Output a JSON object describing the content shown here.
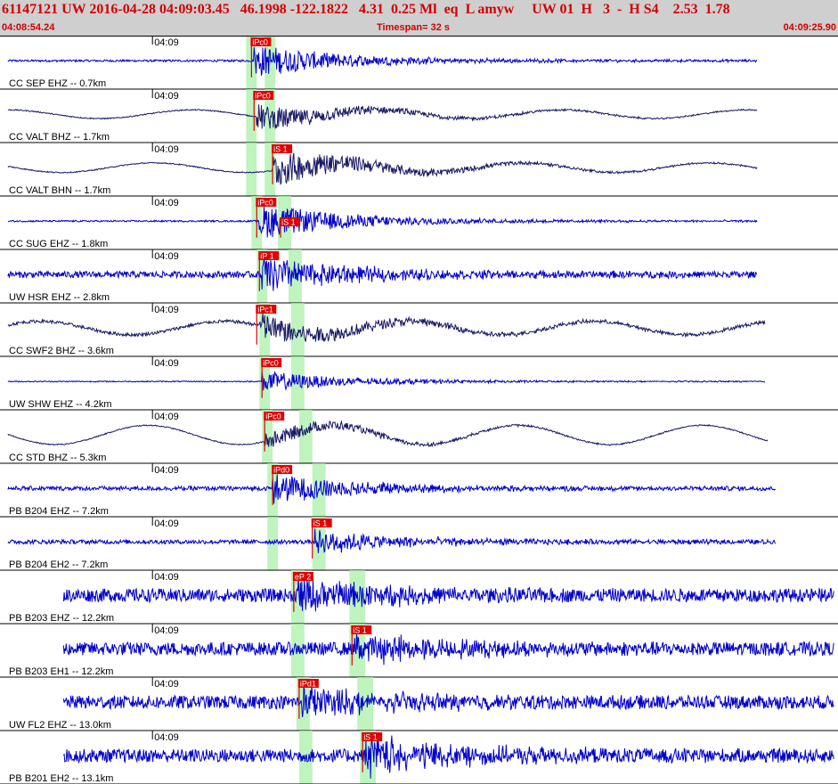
{
  "header": {
    "line1": "61147121 UW 2016-04-28 04:09:03.45   46.1998 -122.1822   4.31  0.25 Ml  eq  L amyw     UW 01  H   3  -  H S4    2.53  1.78",
    "start_time": "04:08:54.24",
    "timespan_label": "Timespan=  32 s",
    "end_time": "04:09:25.90"
  },
  "colors": {
    "header_bg": "#cfcfcf",
    "header_text": "#d40000",
    "trace_primary": "#0000cc",
    "trace_dark": "#1a1a66",
    "pick_flag": "#e00000",
    "phase_window": "#aaf0aa",
    "panel_border": "#000000"
  },
  "chart_data": {
    "type": "line",
    "title": "",
    "xlabel": "",
    "ylabel": "",
    "time_start_s": 0,
    "time_end_s": 31.66,
    "minute_tick_label": "04:09",
    "minute_tick_time_s": 5.76,
    "channels": [
      {
        "label": "CC SEP EHZ -- 0.7km",
        "color": "#0000cc",
        "trace_end_s": 28.6,
        "onset_s": 9.6,
        "amplitude": 0.55,
        "noise": 0.04,
        "wave": 0.0,
        "picks": [
          {
            "label": "iPc0",
            "time_s": 9.5,
            "side": "top"
          }
        ],
        "windows": [
          {
            "start_s": 9.3,
            "end_s": 9.7
          },
          {
            "start_s": 10.0,
            "end_s": 10.4
          }
        ]
      },
      {
        "label": "CC VALT BHZ -- 1.7km",
        "color": "#1a1a66",
        "trace_end_s": 28.6,
        "onset_s": 9.7,
        "amplitude": 0.45,
        "noise": 0.02,
        "wave": 0.18,
        "picks": [
          {
            "label": "iPc0",
            "time_s": 9.6,
            "side": "top"
          }
        ],
        "windows": [
          {
            "start_s": 9.3,
            "end_s": 9.7
          },
          {
            "start_s": 10.0,
            "end_s": 10.4
          }
        ]
      },
      {
        "label": "CC VALT BHN -- 1.7km",
        "color": "#1a1a66",
        "trace_end_s": 28.6,
        "onset_s": 10.3,
        "amplitude": 0.6,
        "noise": 0.02,
        "wave": 0.2,
        "picks": [
          {
            "label": "iS 1",
            "time_s": 10.3,
            "side": "top"
          }
        ],
        "windows": [
          {
            "start_s": 9.3,
            "end_s": 9.7
          },
          {
            "start_s": 10.0,
            "end_s": 10.4
          }
        ]
      },
      {
        "label": "CC SUG EHZ -- 1.8km",
        "color": "#0000cc",
        "trace_end_s": 28.6,
        "onset_s": 9.8,
        "amplitude": 0.6,
        "noise": 0.03,
        "wave": 0.0,
        "picks": [
          {
            "label": "iPc0",
            "time_s": 9.7,
            "side": "top"
          },
          {
            "label": "iS 1",
            "time_s": 10.6,
            "side": "mid"
          }
        ],
        "windows": [
          {
            "start_s": 9.5,
            "end_s": 9.9
          },
          {
            "start_s": 10.5,
            "end_s": 11.0
          }
        ]
      },
      {
        "label": "UW HSR EHZ -- 2.8km",
        "color": "#0000cc",
        "trace_end_s": 28.6,
        "onset_s": 9.9,
        "amplitude": 0.6,
        "noise": 0.12,
        "wave": 0.0,
        "picks": [
          {
            "label": "iP 1",
            "time_s": 9.8,
            "side": "top"
          }
        ],
        "windows": [
          {
            "start_s": 9.7,
            "end_s": 10.1
          },
          {
            "start_s": 10.9,
            "end_s": 11.4
          }
        ]
      },
      {
        "label": "CC SWF2 BHZ -- 3.6km",
        "color": "#1a1a66",
        "trace_end_s": 28.9,
        "onset_s": 9.8,
        "amplitude": 0.5,
        "noise": 0.06,
        "wave": 0.28,
        "picks": [
          {
            "label": "iPc1",
            "time_s": 9.7,
            "side": "top"
          }
        ],
        "windows": [
          {
            "start_s": 9.8,
            "end_s": 10.2
          },
          {
            "start_s": 11.0,
            "end_s": 11.5
          }
        ]
      },
      {
        "label": "UW SHW EHZ -- 4.2km",
        "color": "#0000cc",
        "trace_end_s": 28.9,
        "onset_s": 9.9,
        "amplitude": 0.35,
        "noise": 0.02,
        "wave": 0.0,
        "picks": [
          {
            "label": "iPc0",
            "time_s": 9.9,
            "side": "top"
          }
        ],
        "windows": [
          {
            "start_s": 9.8,
            "end_s": 10.2
          },
          {
            "start_s": 11.0,
            "end_s": 11.5
          }
        ]
      },
      {
        "label": "CC STD BHZ -- 5.3km",
        "color": "#1a1a66",
        "trace_end_s": 29.0,
        "onset_s": 10.0,
        "amplitude": 0.3,
        "noise": 0.02,
        "wave": 0.4,
        "picks": [
          {
            "label": "iPc0",
            "time_s": 10.0,
            "side": "top"
          }
        ],
        "windows": [
          {
            "start_s": 9.9,
            "end_s": 10.3
          },
          {
            "start_s": 11.3,
            "end_s": 11.8
          }
        ]
      },
      {
        "label": "PB B204 EHZ -- 7.2km",
        "color": "#0000cc",
        "trace_end_s": 29.3,
        "onset_s": 10.3,
        "amplitude": 0.5,
        "noise": 0.08,
        "wave": 0.0,
        "picks": [
          {
            "label": "iPd0",
            "time_s": 10.3,
            "side": "top"
          }
        ],
        "windows": [
          {
            "start_s": 10.1,
            "end_s": 10.5
          },
          {
            "start_s": 11.8,
            "end_s": 12.3
          }
        ]
      },
      {
        "label": "PB B204 EH2 -- 7.2km",
        "color": "#0000cc",
        "trace_end_s": 29.3,
        "onset_s": 11.9,
        "amplitude": 0.4,
        "noise": 0.08,
        "wave": 0.0,
        "picks": [
          {
            "label": "iS 1",
            "time_s": 11.8,
            "side": "top"
          }
        ],
        "windows": [
          {
            "start_s": 10.1,
            "end_s": 10.5
          },
          {
            "start_s": 11.8,
            "end_s": 12.3
          }
        ]
      },
      {
        "label": "PB B203 EHZ -- 12.2km",
        "color": "#0000cc",
        "trace_end_s": 31.5,
        "onset_s": 11.2,
        "amplitude": 0.55,
        "noise": 0.25,
        "wave": 0.0,
        "picks": [
          {
            "label": "eP 2",
            "time_s": 11.1,
            "side": "top"
          }
        ],
        "windows": [
          {
            "start_s": 11.0,
            "end_s": 11.5
          },
          {
            "start_s": 13.2,
            "end_s": 13.8
          }
        ]
      },
      {
        "label": "PB B203 EH1 -- 12.2km",
        "color": "#0000cc",
        "trace_end_s": 31.5,
        "onset_s": 13.4,
        "amplitude": 0.5,
        "noise": 0.25,
        "wave": 0.0,
        "picks": [
          {
            "label": "iS 1",
            "time_s": 13.3,
            "side": "top"
          }
        ],
        "windows": [
          {
            "start_s": 11.0,
            "end_s": 11.5
          },
          {
            "start_s": 13.2,
            "end_s": 13.8
          }
        ]
      },
      {
        "label": "UW FL2 EHZ -- 13.0km",
        "color": "#0000cc",
        "trace_end_s": 31.5,
        "onset_s": 11.4,
        "amplitude": 0.5,
        "noise": 0.25,
        "wave": 0.0,
        "picks": [
          {
            "label": "iPd1",
            "time_s": 11.3,
            "side": "top"
          }
        ],
        "windows": [
          {
            "start_s": 11.2,
            "end_s": 11.7
          },
          {
            "start_s": 13.5,
            "end_s": 14.1
          }
        ]
      },
      {
        "label": "PB B201 EH2 -- 13.1km",
        "color": "#0000cc",
        "trace_end_s": 31.5,
        "onset_s": 13.8,
        "amplitude": 0.65,
        "noise": 0.25,
        "wave": 0.0,
        "picks": [
          {
            "label": "iS 1",
            "time_s": 13.7,
            "side": "top"
          }
        ],
        "windows": [
          {
            "start_s": 11.3,
            "end_s": 11.8
          },
          {
            "start_s": 13.6,
            "end_s": 14.2
          }
        ]
      }
    ]
  }
}
